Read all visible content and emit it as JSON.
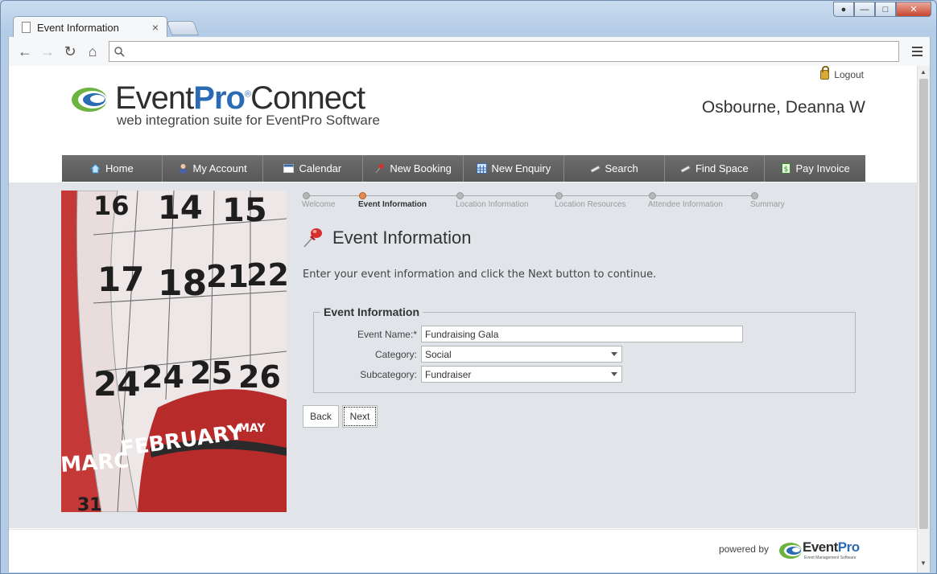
{
  "browser": {
    "tab_title": "Event Information",
    "tab_close": "×",
    "address_value": ""
  },
  "header": {
    "logo": {
      "brand_main": "EventPro",
      "brand_pro": "Pro",
      "brand_event": "Event",
      "brand_connect": "Connect",
      "registered": "®",
      "tagline": "web integration suite for EventPro Software"
    },
    "logout_label": "Logout",
    "user_name": "Osbourne, Deanna W"
  },
  "nav": {
    "items": [
      {
        "label": "Home",
        "icon": "home-icon"
      },
      {
        "label": "My Account",
        "icon": "user-icon"
      },
      {
        "label": "Calendar",
        "icon": "calendar-icon"
      },
      {
        "label": "New Booking",
        "icon": "pushpin-icon"
      },
      {
        "label": "New Enquiry",
        "icon": "grid-calendar-icon"
      },
      {
        "label": "Search",
        "icon": "binoculars-icon"
      },
      {
        "label": "Find Space",
        "icon": "binoculars-icon"
      },
      {
        "label": "Pay Invoice",
        "icon": "money-icon"
      }
    ]
  },
  "hero": {
    "numbers": [
      "16",
      "14",
      "15",
      "17",
      "18",
      "21",
      "22",
      "24",
      "24",
      "25",
      "26",
      "31"
    ],
    "months": [
      "FEBRUARY",
      "MARC",
      "MAY"
    ]
  },
  "steps": {
    "items": [
      {
        "label": "Welcome",
        "active": false
      },
      {
        "label": "Event Information",
        "active": true
      },
      {
        "label": "Location Information",
        "active": false
      },
      {
        "label": "Location Resources",
        "active": false
      },
      {
        "label": "Attendee Information",
        "active": false
      },
      {
        "label": "Summary",
        "active": false
      }
    ]
  },
  "main": {
    "title": "Event Information",
    "instructions": "Enter your event information and click the Next button to continue.",
    "form": {
      "legend": "Event Information",
      "event_name_label": "Event Name:*",
      "event_name_value": "Fundraising Gala",
      "category_label": "Category:",
      "category_value": "Social",
      "subcategory_label": "Subcategory:",
      "subcategory_value": "Fundraiser"
    },
    "back_label": "Back",
    "next_label": "Next"
  },
  "footer": {
    "powered_by": "powered by",
    "logo_event": "Event",
    "logo_pro": "Pro",
    "logo_sub": "Event Management Software"
  },
  "colors": {
    "nav_bg": "#616161",
    "content_bg": "#e1e4e9",
    "brand_blue": "#2a6bb3",
    "active_step": "#e38b52"
  }
}
